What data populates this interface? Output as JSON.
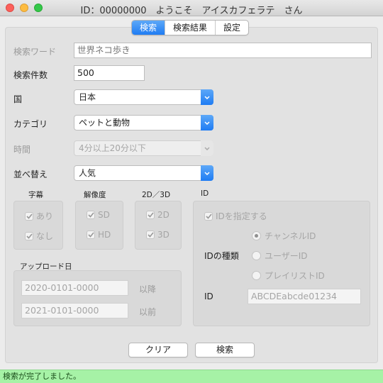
{
  "window": {
    "title": "ID：00000000　ようこそ　アイスカフェラテ　さん"
  },
  "tabs": [
    {
      "label": "検索",
      "active": true
    },
    {
      "label": "検索結果",
      "active": false
    },
    {
      "label": "設定",
      "active": false
    }
  ],
  "form": {
    "keyword": {
      "label": "検索ワード",
      "placeholder": "世界ネコ歩き",
      "value": ""
    },
    "count": {
      "label": "検索件数",
      "value": "500"
    },
    "country": {
      "label": "国",
      "value": "日本"
    },
    "category": {
      "label": "カテゴリ",
      "value": "ペットと動物"
    },
    "duration": {
      "label": "時間",
      "value": "4分以上20分以下"
    },
    "sort": {
      "label": "並べ替え",
      "value": "人気"
    }
  },
  "subtitles": {
    "title": "字幕",
    "options": [
      {
        "label": "あり",
        "checked": true
      },
      {
        "label": "なし",
        "checked": true
      }
    ]
  },
  "resolution": {
    "title": "解像度",
    "options": [
      {
        "label": "SD",
        "checked": true
      },
      {
        "label": "HD",
        "checked": true
      }
    ]
  },
  "dimension": {
    "title": "2D／3D",
    "options": [
      {
        "label": "2D",
        "checked": true
      },
      {
        "label": "3D",
        "checked": true
      }
    ]
  },
  "id_group": {
    "title": "ID",
    "specify_label": "IDを指定する",
    "type_label": "IDの種類",
    "radios": [
      {
        "label": "チャンネルID",
        "selected": true
      },
      {
        "label": "ユーザーID",
        "selected": false
      },
      {
        "label": "プレイリストID",
        "selected": false
      }
    ],
    "id_label": "ID",
    "id_value": "ABCDEabcde01234"
  },
  "upload": {
    "title": "アップロード日",
    "from_value": "2020-0101-0000",
    "from_suffix": "以降",
    "to_value": "2021-0101-0000",
    "to_suffix": "以前"
  },
  "buttons": {
    "clear": "クリア",
    "search": "検索"
  },
  "status": "検索が完了しました。",
  "colors": {
    "accent": "#1f7cf3",
    "status_bg": "#a6f2a6"
  }
}
